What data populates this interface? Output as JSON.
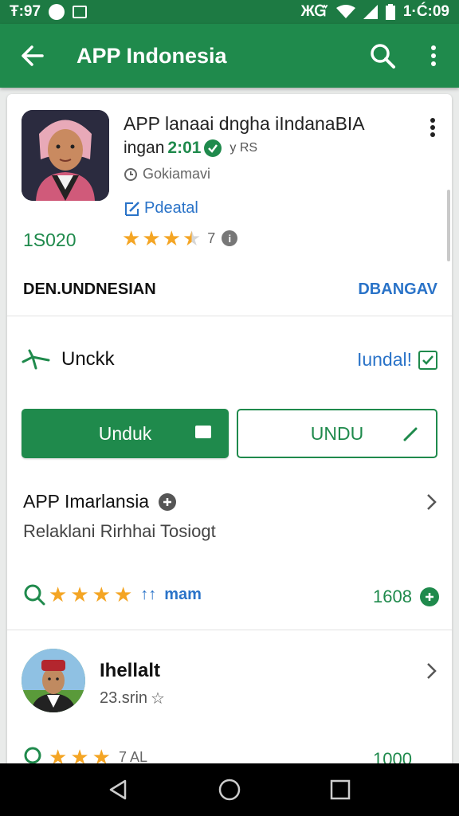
{
  "status_bar": {
    "left_time": "Ŧ:97",
    "right_signal": "ЖᏳ",
    "right_time": "1·Ć:09"
  },
  "app_bar": {
    "title": "APP Indonesia"
  },
  "app": {
    "name": "APP lanaai dngha iIndanaBIA",
    "sub_prefix": "ingan",
    "version": "2:01",
    "sub_extra": "y RS",
    "developer": "Gokiamavi",
    "detail_link": "Pdeatal",
    "downloads": "1S020",
    "rating_value": "7",
    "rating_stars": 3.5
  },
  "developer_section": {
    "label": "DEN.UNDNESIAN",
    "action": "DBANGAV"
  },
  "install_section": {
    "label": "Unckk",
    "status": "Iundal!"
  },
  "buttons": {
    "primary": "Unduk",
    "outline": "UNDU"
  },
  "list_item_1": {
    "title": "APP Imarlansia",
    "subtitle": "Relaklani Rirhhai Tosiogt"
  },
  "rating_row": {
    "stars": 4,
    "text": "mam",
    "number": "1608"
  },
  "list_item_2": {
    "name": "Ihellalt",
    "subtitle": "23.srin"
  },
  "partial_row": {
    "text": "7 AL",
    "number": "1000"
  },
  "colors": {
    "primary_green": "#1f8a4c",
    "status_green": "#1d7a43",
    "link_blue": "#2a73c8",
    "star_yellow": "#f4a524"
  }
}
